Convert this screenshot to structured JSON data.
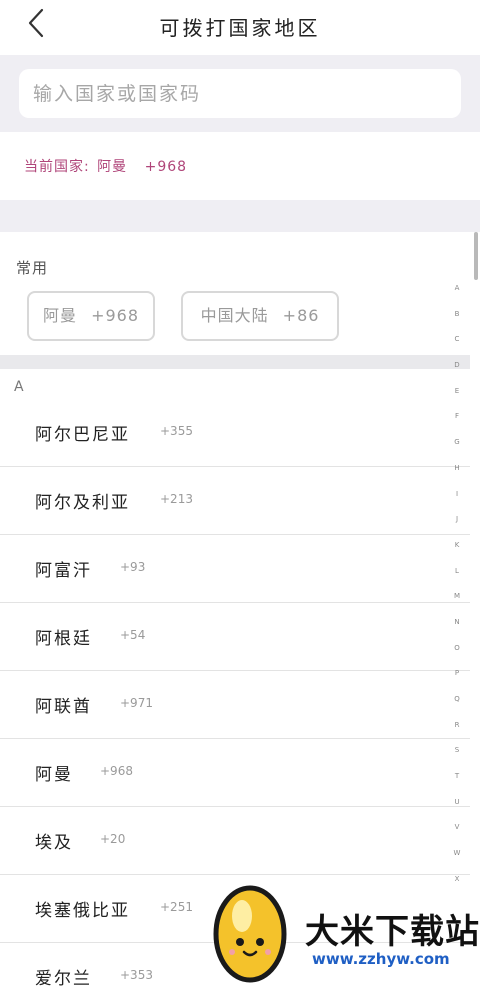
{
  "header": {
    "title": "可拨打国家地区",
    "back_icon": "chevron-left-icon"
  },
  "search": {
    "placeholder": "输入国家或国家码",
    "value": ""
  },
  "current": {
    "label": "当前国家:",
    "country": "阿曼",
    "code": "+968"
  },
  "common": {
    "title": "常用",
    "items": [
      {
        "name": "阿曼",
        "code": "+968"
      },
      {
        "name": "中国大陆",
        "code": "+86"
      }
    ]
  },
  "section_letter": "A",
  "countries": [
    {
      "name": "阿尔巴尼亚",
      "code": "+355"
    },
    {
      "name": "阿尔及利亚",
      "code": "+213"
    },
    {
      "name": "阿富汗",
      "code": "+93"
    },
    {
      "name": "阿根廷",
      "code": "+54"
    },
    {
      "name": "阿联酋",
      "code": "+971"
    },
    {
      "name": "阿曼",
      "code": "+968"
    },
    {
      "name": "埃及",
      "code": "+20"
    },
    {
      "name": "埃塞俄比亚",
      "code": "+251"
    },
    {
      "name": "爱尔兰",
      "code": "+353"
    }
  ],
  "index_letters": [
    "A",
    "B",
    "C",
    "D",
    "E",
    "F",
    "G",
    "H",
    "I",
    "J",
    "K",
    "L",
    "M",
    "N",
    "O",
    "P",
    "Q",
    "R",
    "S",
    "T",
    "U",
    "V",
    "W",
    "X"
  ],
  "watermark": {
    "text": "大米下载站",
    "url": "www.zzhyw.com"
  },
  "colors": {
    "accent": "#b0467a",
    "band": "#efeef3",
    "divider": "#e3e3e3"
  }
}
